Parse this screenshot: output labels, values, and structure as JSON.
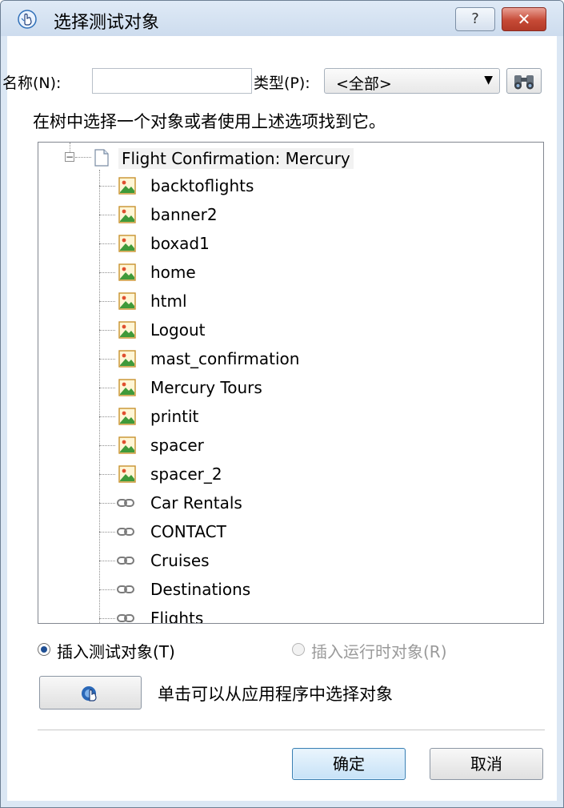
{
  "window": {
    "title": "选择测试对象",
    "help_label": "?",
    "close_label": "✕"
  },
  "search": {
    "name_label": "名称(N):",
    "name_value": "",
    "type_label": "类型(P):",
    "type_selected": "<全部>"
  },
  "instruction": "在树中选择一个对象或者使用上述选项找到它。",
  "tree": {
    "root": {
      "label": "Flight Confirmation: Mercury",
      "icon": "page-icon",
      "expanded": true
    },
    "items": [
      {
        "label": "backtoflights",
        "icon": "image-icon"
      },
      {
        "label": "banner2",
        "icon": "image-icon"
      },
      {
        "label": "boxad1",
        "icon": "image-icon"
      },
      {
        "label": "home",
        "icon": "image-icon"
      },
      {
        "label": "html",
        "icon": "image-icon"
      },
      {
        "label": "Logout",
        "icon": "image-icon"
      },
      {
        "label": "mast_confirmation",
        "icon": "image-icon"
      },
      {
        "label": "Mercury Tours",
        "icon": "image-icon"
      },
      {
        "label": "printit",
        "icon": "image-icon"
      },
      {
        "label": "spacer",
        "icon": "image-icon"
      },
      {
        "label": "spacer_2",
        "icon": "image-icon"
      },
      {
        "label": "Car Rentals",
        "icon": "link-icon"
      },
      {
        "label": "CONTACT",
        "icon": "link-icon"
      },
      {
        "label": "Cruises",
        "icon": "link-icon"
      },
      {
        "label": "Destinations",
        "icon": "link-icon"
      },
      {
        "label": "Flights",
        "icon": "link-icon"
      }
    ]
  },
  "options": {
    "insert_test_object": "插入测试对象(T)",
    "insert_runtime_object": "插入运行时对象(R)",
    "selected": "insert_test_object"
  },
  "pick": {
    "text": "单击可以从应用程序中选择对象"
  },
  "buttons": {
    "ok": "确定",
    "cancel": "取消"
  },
  "colors": {
    "title_bar": "#d5e3f2",
    "close_button": "#c64a36",
    "ok_border": "#3c7fb1",
    "selected_radio": "#1f4f94"
  }
}
